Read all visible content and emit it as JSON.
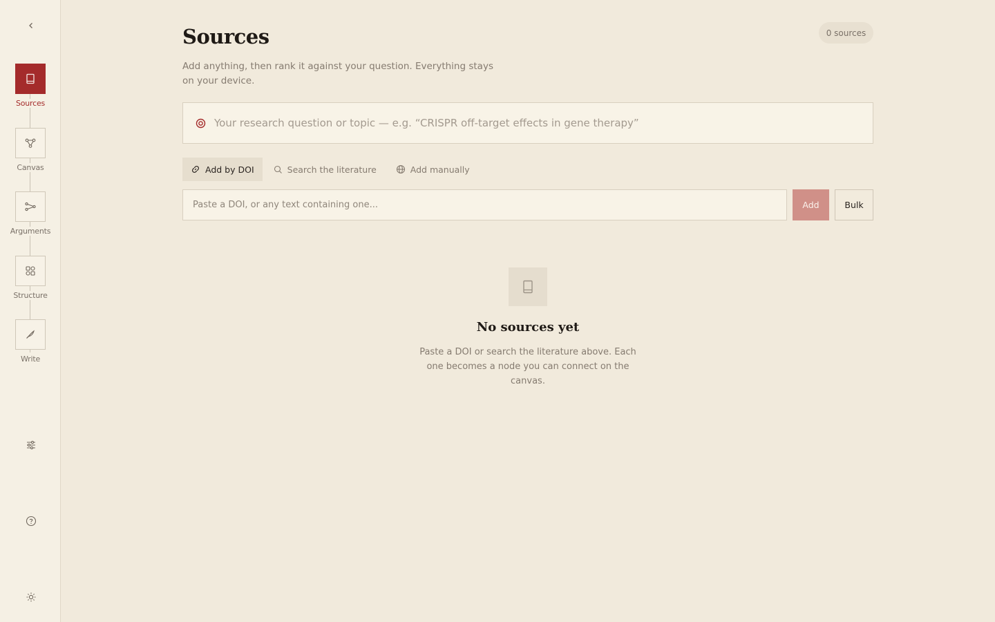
{
  "sidebar": {
    "nav": [
      {
        "label": "Sources",
        "icon": "book-icon",
        "active": true
      },
      {
        "label": "Canvas",
        "icon": "graph-icon",
        "active": false
      },
      {
        "label": "Arguments",
        "icon": "branch-icon",
        "active": false
      },
      {
        "label": "Structure",
        "icon": "grid-icon",
        "active": false
      },
      {
        "label": "Write",
        "icon": "feather-icon",
        "active": false
      }
    ],
    "bottom_icons": [
      "sliders-icon",
      "help-icon",
      "sun-icon"
    ]
  },
  "header": {
    "title": "Sources",
    "count_badge": "0 sources",
    "subtitle": "Add anything, then rank it against your question. Everything stays on your device."
  },
  "question": {
    "placeholder": "Your research question or topic — e.g. “CRISPR off-target effects in gene therapy”"
  },
  "tabs": [
    {
      "label": "Add by DOI",
      "icon": "link-icon",
      "active": true
    },
    {
      "label": "Search the literature",
      "icon": "search-icon",
      "active": false
    },
    {
      "label": "Add manually",
      "icon": "globe-icon",
      "active": false
    }
  ],
  "doi": {
    "placeholder": "Paste a DOI, or any text containing one...",
    "add_label": "Add",
    "bulk_label": "Bulk"
  },
  "empty_state": {
    "title": "No sources yet",
    "text": "Paste a DOI or search the literature above. Each one becomes a node you can connect on the canvas."
  },
  "colors": {
    "accent": "#a42b2b",
    "background": "#f1eadc",
    "sidebar": "#f5f0e4"
  }
}
